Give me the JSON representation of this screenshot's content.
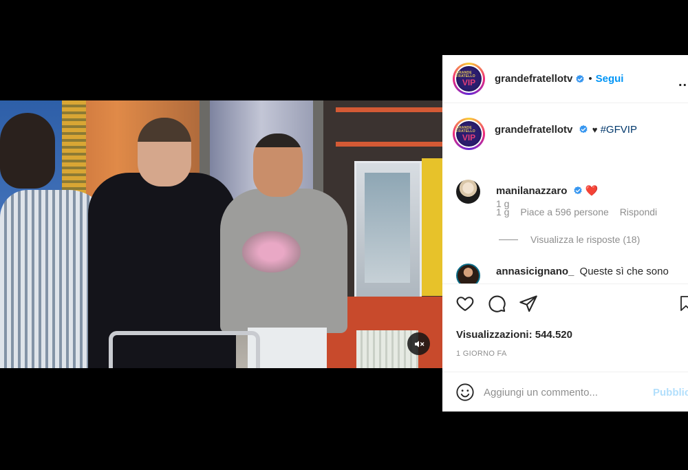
{
  "post": {
    "username": "grandefratellotv",
    "separator": "•",
    "follow_label": "Segui",
    "more_label": "...",
    "avatar_logo_small": "GRANDE FRATELLO",
    "avatar_logo_vip": "VIP"
  },
  "caption": {
    "username": "grandefratellotv",
    "heart": "♥",
    "hashtag": "#GFVIP",
    "time": "1 g"
  },
  "comments": [
    {
      "username": "manilanazzaro",
      "emoji": "❤️",
      "time": "1 g",
      "likes": "Piace a 596 persone",
      "reply_label": "Rispondi",
      "view_replies": "Visualizza le risposte (18)"
    },
    {
      "username": "annasicignano_",
      "text": "Queste sì che sono"
    }
  ],
  "stats": {
    "views": "Visualizzazioni: 544.520",
    "date": "1 GIORNO FA"
  },
  "add_comment": {
    "placeholder": "Aggiungi un commento...",
    "publish_label": "Pubblica"
  },
  "colors": {
    "accent": "#0095f6",
    "verified": "#3897f0",
    "publish_disabled": "#b2dffc",
    "meta_gray": "#8e8e8e"
  },
  "icons": [
    "verified-icon",
    "heart-icon",
    "comment-icon",
    "share-icon",
    "bookmark-icon",
    "emoji-icon",
    "mute-icon",
    "more-icon"
  ]
}
